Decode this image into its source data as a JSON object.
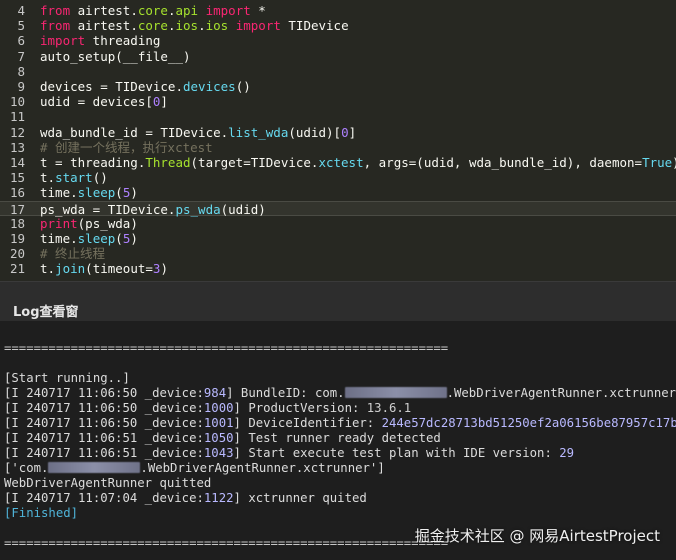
{
  "editor": {
    "lines": [
      {
        "num": "4",
        "parts": [
          [
            "kw",
            "from"
          ],
          [
            "t",
            " airtest"
          ],
          [
            "t",
            "."
          ],
          [
            "mod",
            "core"
          ],
          [
            "t",
            "."
          ],
          [
            "mod",
            "api"
          ],
          [
            "t",
            " "
          ],
          [
            "kw",
            "import"
          ],
          [
            "t",
            " *"
          ]
        ]
      },
      {
        "num": "5",
        "parts": [
          [
            "kw",
            "from"
          ],
          [
            "t",
            " airtest"
          ],
          [
            "t",
            "."
          ],
          [
            "mod",
            "core"
          ],
          [
            "t",
            "."
          ],
          [
            "mod",
            "ios"
          ],
          [
            "t",
            "."
          ],
          [
            "mod",
            "ios"
          ],
          [
            "t",
            " "
          ],
          [
            "kw",
            "import"
          ],
          [
            "t",
            " TIDevice"
          ]
        ]
      },
      {
        "num": "6",
        "parts": [
          [
            "kw",
            "import"
          ],
          [
            "t",
            " threading"
          ]
        ]
      },
      {
        "num": "7",
        "parts": [
          [
            "t",
            "auto_setup(__file__)"
          ]
        ]
      },
      {
        "num": "8",
        "parts": []
      },
      {
        "num": "9",
        "parts": [
          [
            "t",
            "devices = TIDevice."
          ],
          [
            "fn",
            "devices"
          ],
          [
            "t",
            "()"
          ]
        ]
      },
      {
        "num": "10",
        "parts": [
          [
            "t",
            "udid = devices["
          ],
          [
            "num",
            "0"
          ],
          [
            "t",
            "]"
          ]
        ]
      },
      {
        "num": "11",
        "parts": []
      },
      {
        "num": "12",
        "parts": [
          [
            "t",
            "wda_bundle_id = TIDevice."
          ],
          [
            "fn",
            "list_wda"
          ],
          [
            "t",
            "(udid)["
          ],
          [
            "num",
            "0"
          ],
          [
            "t",
            "]"
          ]
        ]
      },
      {
        "num": "13",
        "parts": [
          [
            "cm",
            "# 创建一个线程，执行xctest"
          ]
        ]
      },
      {
        "num": "14",
        "parts": [
          [
            "t",
            "t = threading."
          ],
          [
            "cls",
            "Thread"
          ],
          [
            "t",
            "(target=TIDevice."
          ],
          [
            "fn",
            "xctest"
          ],
          [
            "t",
            ", args=(udid, wda_bundle_id), daemon="
          ],
          [
            "fn",
            "True"
          ],
          [
            "t",
            ")"
          ]
        ]
      },
      {
        "num": "15",
        "parts": [
          [
            "t",
            "t."
          ],
          [
            "fn",
            "start"
          ],
          [
            "t",
            "()"
          ]
        ]
      },
      {
        "num": "16",
        "parts": [
          [
            "t",
            "time."
          ],
          [
            "fn",
            "sleep"
          ],
          [
            "t",
            "("
          ],
          [
            "num",
            "5"
          ],
          [
            "t",
            ")"
          ]
        ]
      },
      {
        "num": "17",
        "parts": [
          [
            "t",
            "ps_wda = TIDevice."
          ],
          [
            "fn",
            "ps_wda"
          ],
          [
            "t",
            "(udid)"
          ]
        ],
        "active": true
      },
      {
        "num": "18",
        "parts": [
          [
            "kw",
            "print"
          ],
          [
            "t",
            "(ps_wda)"
          ]
        ]
      },
      {
        "num": "19",
        "parts": [
          [
            "t",
            "time."
          ],
          [
            "fn",
            "sleep"
          ],
          [
            "t",
            "("
          ],
          [
            "num",
            "5"
          ],
          [
            "t",
            ")"
          ]
        ]
      },
      {
        "num": "20",
        "parts": [
          [
            "cm",
            "# 终止线程"
          ]
        ]
      },
      {
        "num": "21",
        "parts": [
          [
            "t",
            "t."
          ],
          [
            "fn",
            "join"
          ],
          [
            "t",
            "(timeout="
          ],
          [
            "num",
            "3"
          ],
          [
            "t",
            ")"
          ]
        ]
      }
    ]
  },
  "log_panel": {
    "title": "Log查看窗",
    "separator": "============================================================",
    "start": "[Start running..]",
    "entries": [
      {
        "prefix": "[I 240717 11:06:50 _device:",
        "dev": "984",
        "msg_a": "] BundleID: com.",
        "msg_b": ".WebDriverAgentRunner.xctrunner"
      },
      {
        "prefix": "[I 240717 11:06:50 _device:",
        "dev": "1000",
        "msg_a": "] ProductVersion: ",
        "msg_b": "13.6.1"
      },
      {
        "prefix": "[I 240717 11:06:50 _device:",
        "dev": "1001",
        "msg_a": "] DeviceIdentifier: ",
        "msg_b": "244e57dc28713bd51250ef2a06156be87957c17b"
      },
      {
        "prefix": "[I 240717 11:06:51 _device:",
        "dev": "1050",
        "msg_a": "] Test runner ready detected",
        "msg_b": ""
      },
      {
        "prefix": "[I 240717 11:06:51 _device:",
        "dev": "1043",
        "msg_a": "] Start execute test plan with IDE version: ",
        "msg_b": "29"
      }
    ],
    "list_line_a": "['com.",
    "list_line_b": ".WebDriverAgentRunner.xctrunner']",
    "quit_line": "WebDriverAgentRunner quitted",
    "last_entry": {
      "prefix": "[I 240717 11:07:04 _device:",
      "dev": "1122",
      "msg": "] xctrunner quited"
    },
    "finished": "[Finished]"
  },
  "watermark": "掘金技术社区 @ 网易AirtestProject"
}
